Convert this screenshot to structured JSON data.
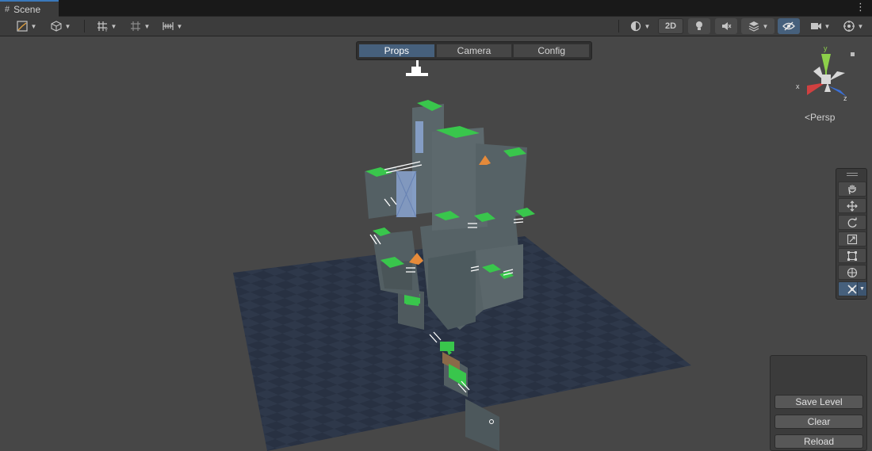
{
  "window": {
    "tab_title": "Scene",
    "tab_icon": "hash-icon",
    "menu_glyph": "⋮"
  },
  "toolbar": {
    "two_d_label": "2D",
    "left_tools": [
      "draw-mode-icon",
      "shading-icon",
      "grid-snap-icon",
      "increment-snap-icon",
      "ruler-icon"
    ],
    "right_tools": [
      "render-mode-icon",
      "2d-toggle",
      "lighting-icon",
      "audio-icon",
      "effects-icon",
      "hidden-objects-icon",
      "camera-icon",
      "gizmos-icon"
    ]
  },
  "overlay_tabs": {
    "items": [
      "Props",
      "Camera",
      "Config"
    ],
    "active": "Props"
  },
  "orientation_gizmo": {
    "y_label": "y",
    "x_label": "x",
    "z_label": "z",
    "projection_label": "Persp",
    "colors": {
      "x": "#d04040",
      "y": "#8dd04a",
      "z": "#3a6fd6",
      "neutral": "#d8d8d8"
    }
  },
  "tools_palette": {
    "items": [
      "hand-icon",
      "move-icon",
      "rotate-icon",
      "scale-icon",
      "rect-icon",
      "transform-icon",
      "custom-tool-icon"
    ],
    "active": "custom-tool-icon"
  },
  "level_panel": {
    "save_label": "Save Level",
    "clear_label": "Clear",
    "reload_label": "Reload"
  },
  "scene_colors": {
    "viewport_bg": "#474747",
    "floor": "#283142",
    "block": "#546064",
    "grass": "#39c64c",
    "accent_orange": "#e58a3a",
    "glass": "#8ca7d4"
  }
}
